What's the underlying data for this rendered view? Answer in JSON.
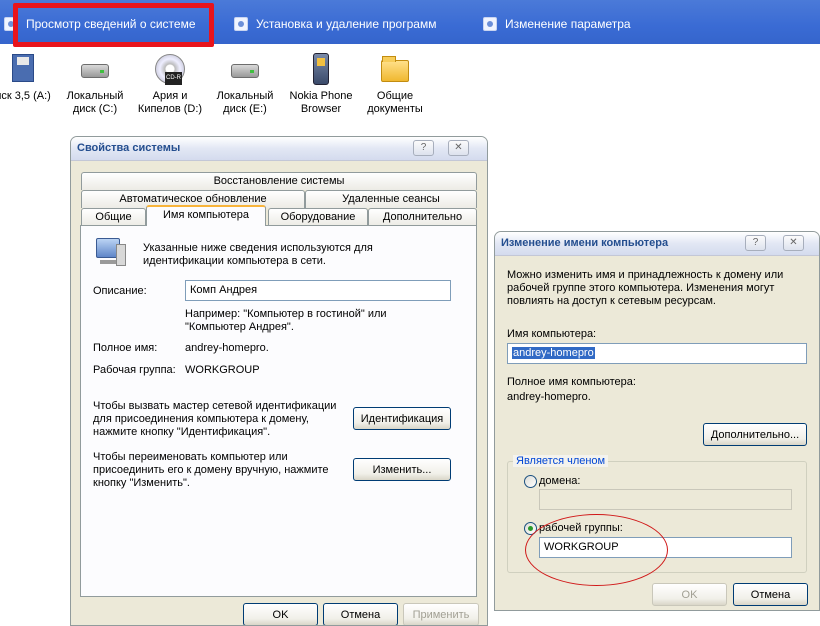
{
  "taskbar": {
    "tasks": [
      {
        "label": "Просмотр сведений о системе"
      },
      {
        "label": "Установка и удаление программ"
      },
      {
        "label": "Изменение параметра"
      }
    ]
  },
  "desktop_icons": [
    {
      "label_line1": "иск 3,5 (A:)",
      "label_line2": "",
      "icon": "floppy-icon"
    },
    {
      "label_line1": "Локальный",
      "label_line2": "диск (C:)",
      "icon": "hard-drive-icon"
    },
    {
      "label_line1": "Ария и",
      "label_line2": "Кипелов (D:)",
      "icon": "cd-icon"
    },
    {
      "label_line1": "Локальный",
      "label_line2": "диск (E:)",
      "icon": "hard-drive-icon"
    },
    {
      "label_line1": "Nokia Phone",
      "label_line2": "Browser",
      "icon": "phone-icon"
    },
    {
      "label_line1": "Общие",
      "label_line2": "документы",
      "icon": "folder-icon"
    }
  ],
  "sysprops": {
    "title": "Свойства системы",
    "help_btn": "?",
    "close_btn": "✕",
    "tabs_row1": [
      "Восстановление системы"
    ],
    "tabs_row2": [
      "Автоматическое обновление",
      "Удаленные сеансы"
    ],
    "tabs_row3": [
      "Общие",
      "Имя компьютера",
      "Оборудование",
      "Дополнительно"
    ],
    "info_line1": "Указанные ниже сведения используются для",
    "info_line2": "идентификации компьютера в сети.",
    "description_label": "Описание:",
    "description_value": "Комп Андрея",
    "example_line1": "Например: \"Компьютер в гостиной\" или",
    "example_line2": "\"Компьютер Андрея\".",
    "fullname_label": "Полное имя:",
    "fullname_value": "andrey-homepro.",
    "workgroup_label": "Рабочая группа:",
    "workgroup_value": "WORKGROUP",
    "wizard_line1": "Чтобы вызвать мастер сетевой идентификации",
    "wizard_line2": "для присоединения компьютера к домену,",
    "wizard_line3": "нажмите кнопку \"Идентификация\".",
    "identify_button": "Идентификация",
    "rename_line1": "Чтобы переименовать компьютер или",
    "rename_line2": "присоединить его к домену вручную, нажмите",
    "rename_line3": "кнопку \"Изменить\".",
    "change_button": "Изменить...",
    "ok_button": "OK",
    "cancel_button": "Отмена",
    "apply_button": "Применить"
  },
  "rename": {
    "title": "Изменение имени компьютера",
    "help_btn": "?",
    "close_btn": "✕",
    "intro_line1": "Можно изменить имя и принадлежность к домену или",
    "intro_line2": "рабочей группе этого компьютера. Изменения могут",
    "intro_line3": "повлиять на доступ к сетевым ресурсам.",
    "computer_name_label": "Имя компьютера:",
    "computer_name_value": "andrey-homepro",
    "full_name_label": "Полное имя компьютера:",
    "full_name_value": "andrey-homepro.",
    "more_button": "Дополнительно...",
    "member_legend": "Является членом",
    "domain_label": "домена:",
    "domain_value": "",
    "workgroup_label": "рабочей группы:",
    "workgroup_value": "WORKGROUP",
    "ok_button": "OK",
    "cancel_button": "Отмена"
  },
  "colors": {
    "taskbar": "#3a6bd4",
    "highlight_red": "#e8141c",
    "dialog_bg": "#ece9d8",
    "selection": "#316ac5"
  }
}
